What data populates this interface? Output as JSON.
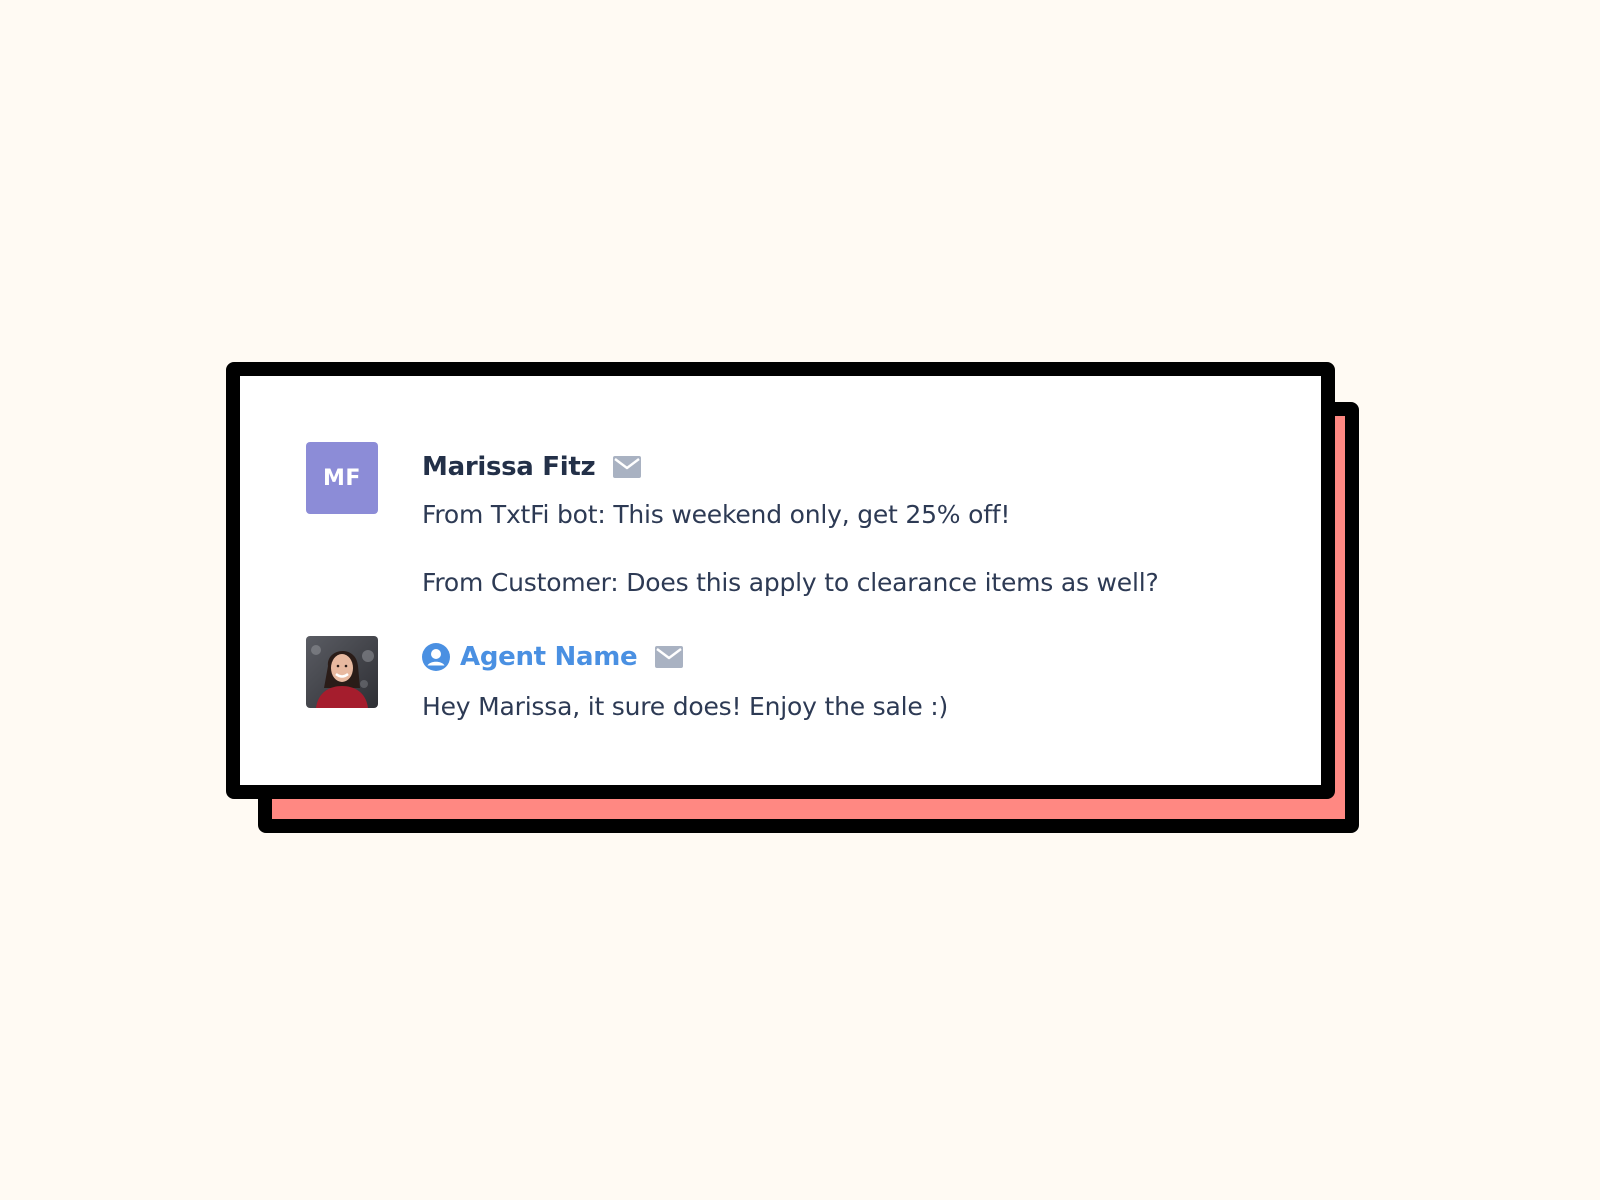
{
  "thread": {
    "customer": {
      "initials": "MF",
      "name": "Marissa Fitz",
      "message_1": "From TxtFi bot: This weekend only, get 25% off!",
      "message_2": "From Customer: Does this apply to clearance items as well?"
    },
    "agent": {
      "name": "Agent Name",
      "message": "Hey Marissa, it sure does! Enjoy the sale :)"
    }
  },
  "icons": {
    "customer_channel": "mail-icon",
    "agent_channel": "mail-icon",
    "agent_badge": "user-circle-icon"
  },
  "colors": {
    "background": "#fffaf3",
    "shadow_card": "#ff8882",
    "border": "#000000",
    "avatar_initials_bg": "#8c8cd7",
    "agent_accent": "#4a90e2",
    "text": "#2d3a54"
  }
}
